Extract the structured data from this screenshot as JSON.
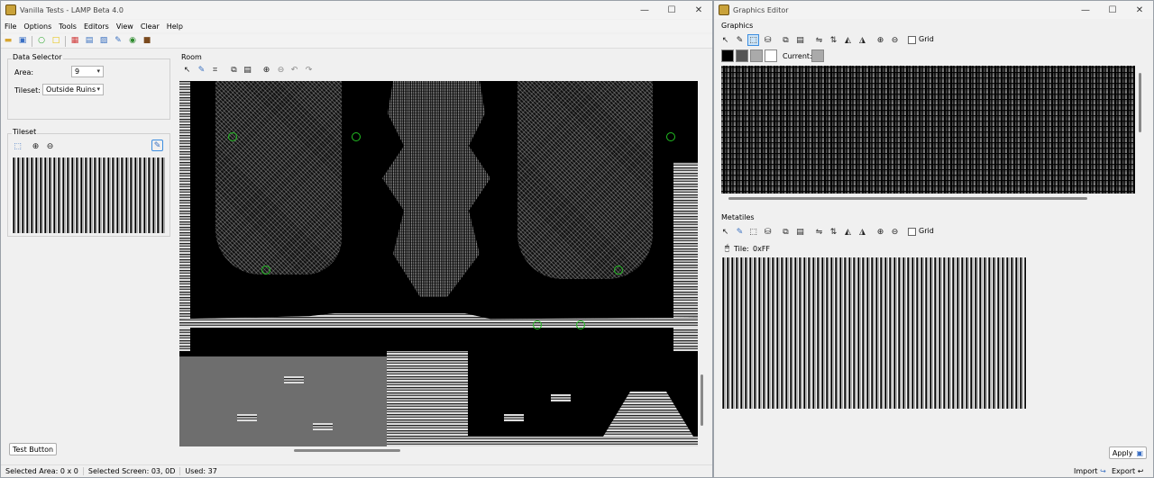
{
  "main_window": {
    "title": "Vanilla Tests - LAMP Beta 4.0",
    "menu": [
      "File",
      "Options",
      "Tools",
      "Editors",
      "View",
      "Clear",
      "Help"
    ],
    "data_selector": {
      "title": "Data Selector",
      "area_label": "Area:",
      "area_value": "9",
      "tileset_label": "Tileset:",
      "tileset_value": "Outside Ruins"
    },
    "tileset_panel": {
      "title": "Tileset"
    },
    "room_panel": {
      "title": "Room"
    },
    "test_button": "Test Button",
    "status": {
      "selected_area": "Selected Area: 0 x 0",
      "selected_screen": "Selected Screen: 03, 0D",
      "used": "Used: 37"
    }
  },
  "graphics_editor": {
    "title": "Graphics Editor",
    "graphics_section": "Graphics",
    "grid_label": "Grid",
    "current_label": "Current:",
    "palette": [
      "#000000",
      "#555555",
      "#aaaaaa",
      "#ffffff"
    ],
    "current_color": "#aaaaaa",
    "metatiles_section": "Metatiles",
    "metatile_grid_label": "Grid",
    "tile_label": "Tile:",
    "tile_value": "0xFF",
    "apply_button": "Apply",
    "import_button": "Import",
    "export_button": "Export"
  },
  "icons": {
    "window_controls": [
      "minimize-icon",
      "maximize-icon",
      "close-icon"
    ],
    "glyphs": {
      "minimize": "—",
      "maximize": "☐",
      "close": "✕"
    }
  }
}
